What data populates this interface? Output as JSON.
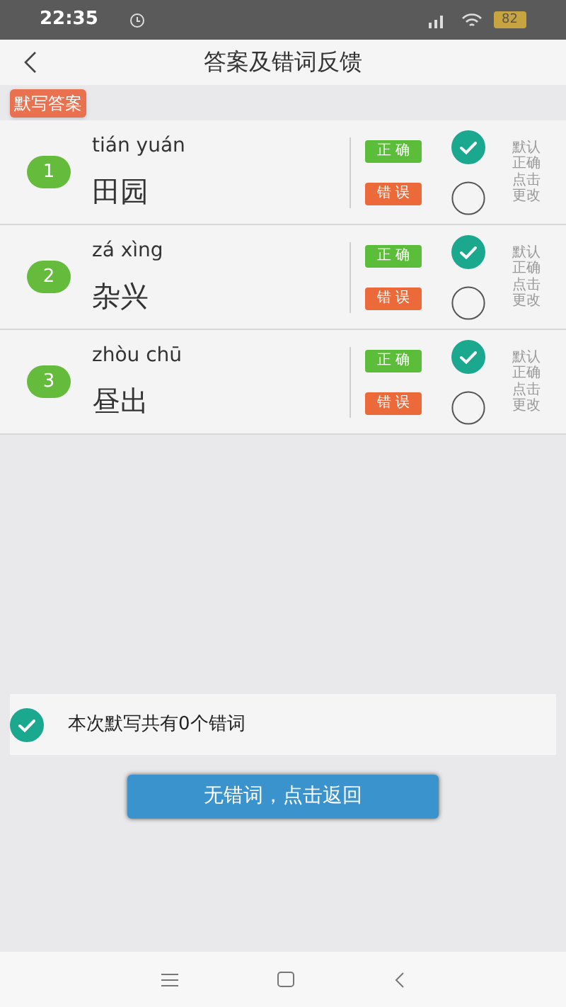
{
  "status_bar": {
    "time": "22:35",
    "battery": "82"
  },
  "header": {
    "title": "答案及错词反馈"
  },
  "section_tag": "默写答案",
  "items": [
    {
      "number": "1",
      "pinyin": "tián yuán",
      "word": "田园",
      "correct_label": "正 确",
      "wrong_label": "错 误",
      "correct_selected": true,
      "hint": "默认正确点击更改"
    },
    {
      "number": "2",
      "pinyin": "zá xìng",
      "word": "杂兴",
      "correct_label": "正 确",
      "wrong_label": "错 误",
      "correct_selected": true,
      "hint": "默认正确点击更改"
    },
    {
      "number": "3",
      "pinyin": "zhòu chū",
      "word": "昼出",
      "correct_label": "正 确",
      "wrong_label": "错 误",
      "correct_selected": true,
      "hint": "默认正确点击更改"
    }
  ],
  "summary": {
    "checked": true,
    "text": "本次默写共有0个错词"
  },
  "return_button": "无错词，点击返回"
}
